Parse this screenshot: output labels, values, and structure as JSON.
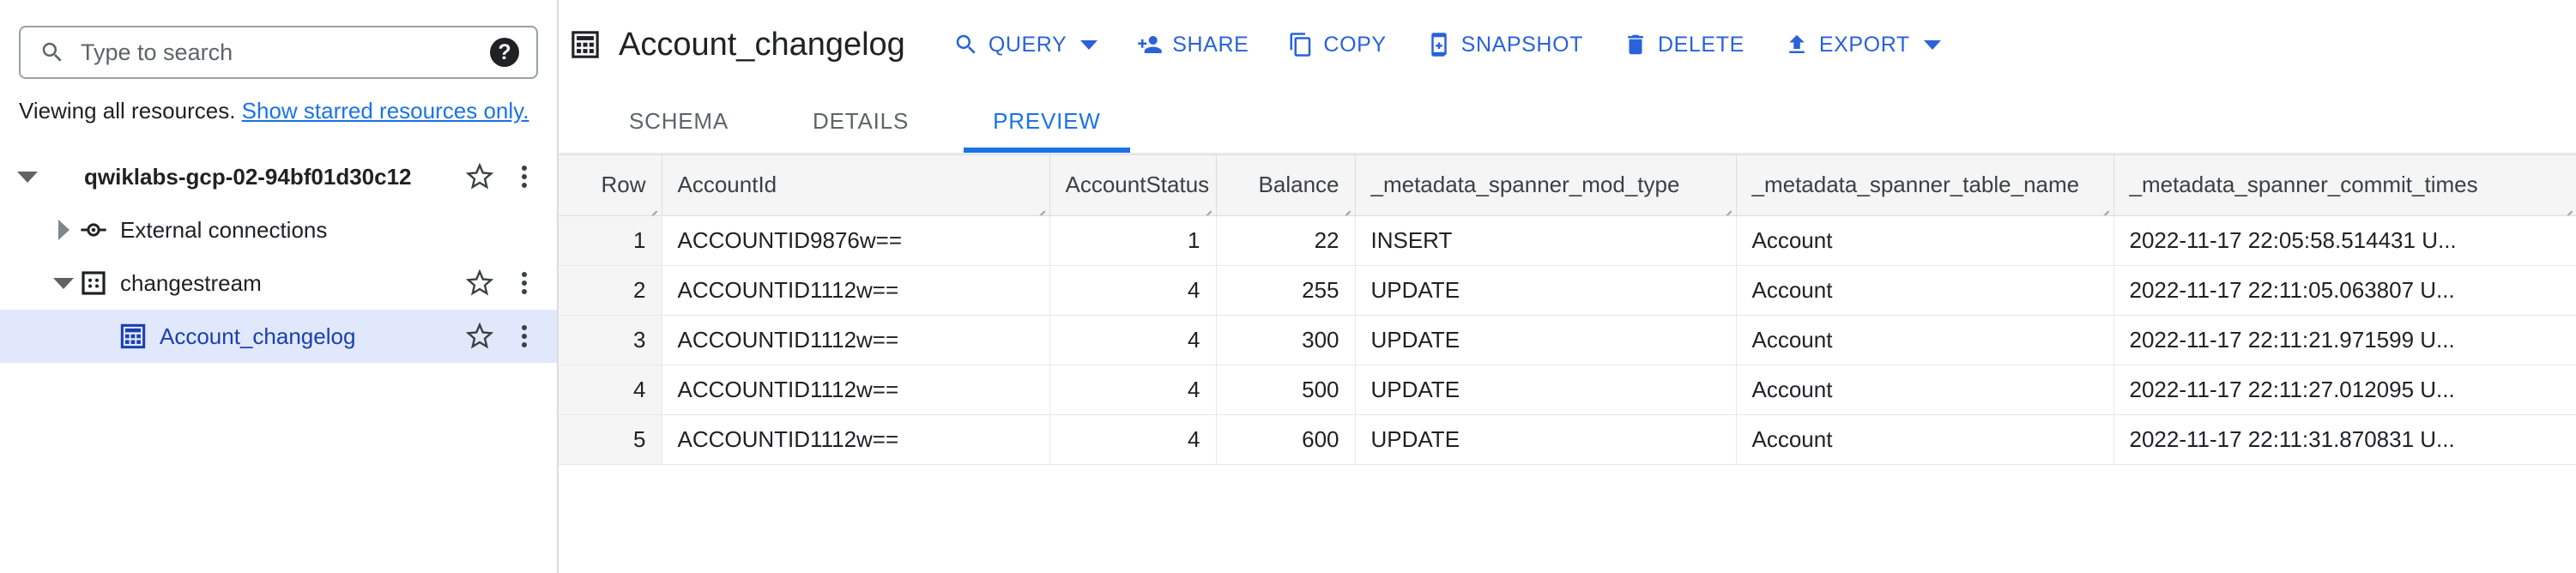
{
  "sidebar": {
    "search": {
      "placeholder": "Type to search",
      "value": "",
      "help_label": "?"
    },
    "viewing_note": {
      "prefix": "Viewing all resources.",
      "link": "Show starred resources only."
    },
    "tree": [
      {
        "label": "qwiklabs-gcp-02-94bf01d30c12",
        "level": 0,
        "caret": "down",
        "icon": "none",
        "bold": true,
        "selected": false,
        "has_star": true,
        "has_menu": true
      },
      {
        "label": "External connections",
        "level": 1,
        "caret": "right",
        "icon": "external-connection-icon",
        "bold": false,
        "selected": false,
        "has_star": false,
        "has_menu": false
      },
      {
        "label": "changestream",
        "level": 1,
        "caret": "down",
        "icon": "dataset-icon",
        "bold": false,
        "selected": false,
        "has_star": true,
        "has_menu": true
      },
      {
        "label": "Account_changelog",
        "level": 2,
        "caret": "none",
        "icon": "table-icon",
        "bold": false,
        "selected": true,
        "has_star": true,
        "has_menu": true
      }
    ]
  },
  "header": {
    "title": "Account_changelog",
    "title_icon": "table-icon",
    "actions": [
      {
        "label": "QUERY",
        "icon": "search-icon",
        "dropdown": true
      },
      {
        "label": "SHARE",
        "icon": "person-add-icon",
        "dropdown": false
      },
      {
        "label": "COPY",
        "icon": "copy-icon",
        "dropdown": false
      },
      {
        "label": "SNAPSHOT",
        "icon": "snapshot-icon",
        "dropdown": false
      },
      {
        "label": "DELETE",
        "icon": "trash-icon",
        "dropdown": false
      },
      {
        "label": "EXPORT",
        "icon": "export-icon",
        "dropdown": true
      }
    ]
  },
  "tabs": [
    {
      "label": "SCHEMA",
      "active": false
    },
    {
      "label": "DETAILS",
      "active": false
    },
    {
      "label": "PREVIEW",
      "active": true
    }
  ],
  "table": {
    "columns": [
      {
        "key": "row",
        "label": "Row",
        "align": "right",
        "cls": "c-row"
      },
      {
        "key": "acct",
        "label": "AccountId",
        "align": "left",
        "cls": "c-acct"
      },
      {
        "key": "stat",
        "label": "AccountStatus",
        "align": "right",
        "cls": "c-stat"
      },
      {
        "key": "bal",
        "label": "Balance",
        "align": "right",
        "cls": "c-bal"
      },
      {
        "key": "mod",
        "label": "_metadata_spanner_mod_type",
        "align": "left",
        "cls": "c-mod"
      },
      {
        "key": "tbl",
        "label": "_metadata_spanner_table_name",
        "align": "left",
        "cls": "c-tbl"
      },
      {
        "key": "ts",
        "label": "_metadata_spanner_commit_times",
        "align": "left",
        "cls": "c-ts"
      }
    ],
    "rows": [
      {
        "row": "1",
        "acct": "ACCOUNTID9876w==",
        "stat": "1",
        "bal": "22",
        "mod": "INSERT",
        "tbl": "Account",
        "ts": "2022-11-17 22:05:58.514431 U..."
      },
      {
        "row": "2",
        "acct": "ACCOUNTID1112w==",
        "stat": "4",
        "bal": "255",
        "mod": "UPDATE",
        "tbl": "Account",
        "ts": "2022-11-17 22:11:05.063807 U..."
      },
      {
        "row": "3",
        "acct": "ACCOUNTID1112w==",
        "stat": "4",
        "bal": "300",
        "mod": "UPDATE",
        "tbl": "Account",
        "ts": "2022-11-17 22:11:21.971599 U..."
      },
      {
        "row": "4",
        "acct": "ACCOUNTID1112w==",
        "stat": "4",
        "bal": "500",
        "mod": "UPDATE",
        "tbl": "Account",
        "ts": "2022-11-17 22:11:27.012095 U..."
      },
      {
        "row": "5",
        "acct": "ACCOUNTID1112w==",
        "stat": "4",
        "bal": "600",
        "mod": "UPDATE",
        "tbl": "Account",
        "ts": "2022-11-17 22:11:31.870831 U..."
      }
    ]
  },
  "colors": {
    "accent": "#1a73e8",
    "action_blue": "#2962d9",
    "selected_row_bg": "#e1e8fb",
    "header_bg": "#f5f5f5",
    "text": "#202124",
    "muted": "#5f6368"
  }
}
